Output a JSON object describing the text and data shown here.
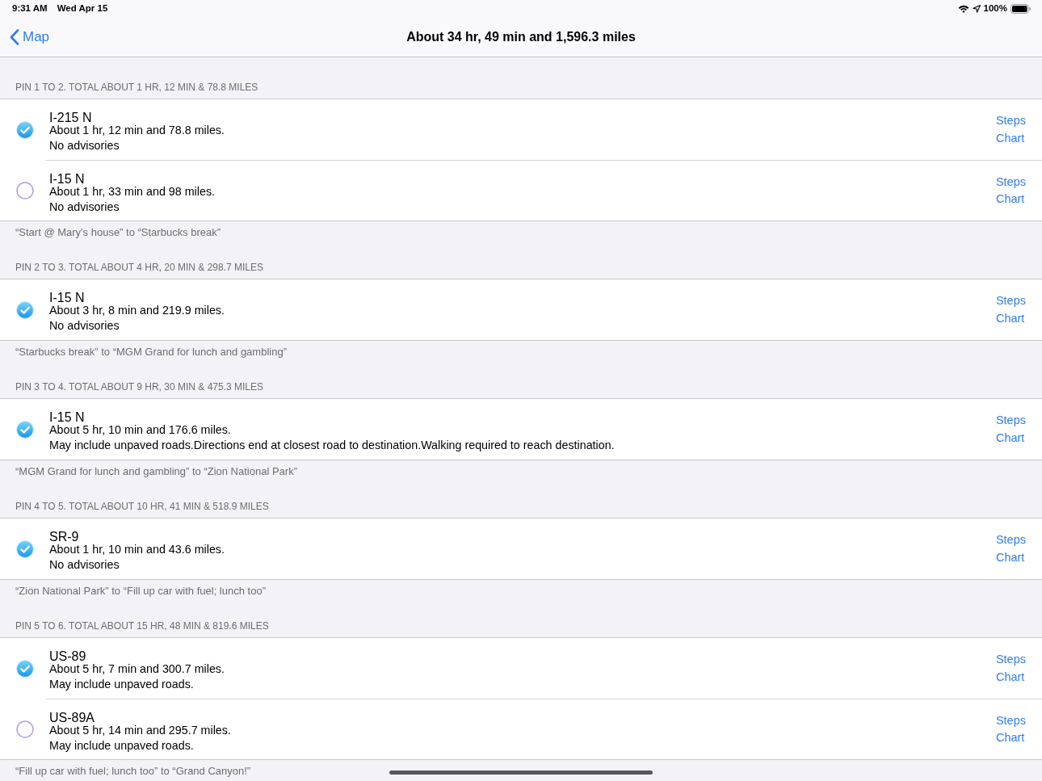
{
  "status_bar": {
    "time": "9:31 AM",
    "date": "Wed Apr 15",
    "battery": "100%"
  },
  "nav_bar": {
    "back": "Map",
    "title": "About 34 hr, 49 min and 1,596.3 miles"
  },
  "sections": [
    {
      "header": "PIN 1 TO 2. TOTAL ABOUT 1 HR, 12 MIN & 78.8 MILES",
      "routes": [
        {
          "name": "I-215 N",
          "summary": "About 1 hr, 12 min and 78.8 miles.",
          "advisory": "No advisories",
          "selected": true,
          "actions": [
            "Steps",
            "Chart"
          ]
        },
        {
          "name": "I-15 N",
          "summary": "About 1 hr, 33 min and 98 miles.",
          "advisory": "No advisories",
          "selected": false,
          "actions": [
            "Steps",
            "Chart"
          ]
        }
      ],
      "footer": "“Start @ Mary's house” to “Starbucks break”"
    },
    {
      "header": "PIN 2 TO 3. TOTAL ABOUT 4 HR, 20 MIN & 298.7 MILES",
      "routes": [
        {
          "name": "I-15 N",
          "summary": "About 3 hr, 8 min and 219.9 miles.",
          "advisory": "No advisories",
          "selected": true,
          "actions": [
            "Steps",
            "Chart"
          ]
        }
      ],
      "footer": "“Starbucks break” to “MGM Grand for lunch and gambling”"
    },
    {
      "header": "PIN 3 TO 4. TOTAL ABOUT 9 HR, 30 MIN & 475.3 MILES",
      "routes": [
        {
          "name": "I-15 N",
          "summary": "About 5 hr, 10 min and 176.6 miles.",
          "advisory": "May include unpaved roads.Directions end at closest road to destination.Walking required to reach destination.",
          "selected": true,
          "actions": [
            "Steps",
            "Chart"
          ]
        }
      ],
      "footer": "“MGM Grand for lunch and gambling” to “Zion National Park”"
    },
    {
      "header": "PIN 4 TO 5. TOTAL ABOUT 10 HR, 41 MIN & 518.9 MILES",
      "routes": [
        {
          "name": "SR-9",
          "summary": "About 1 hr, 10 min and 43.6 miles.",
          "advisory": "No advisories",
          "selected": true,
          "actions": [
            "Steps",
            "Chart"
          ]
        }
      ],
      "footer": "“Zion National Park” to “Fill up car with fuel; lunch too”"
    },
    {
      "header": "PIN 5 TO 6. TOTAL ABOUT 15 HR, 48 MIN & 819.6 MILES",
      "routes": [
        {
          "name": "US-89",
          "summary": "About 5 hr, 7 min and 300.7 miles.",
          "advisory": "May include unpaved roads.",
          "selected": true,
          "actions": [
            "Steps",
            "Chart"
          ]
        },
        {
          "name": "US-89A",
          "summary": "About 5 hr, 14 min and 295.7 miles.",
          "advisory": "May include unpaved roads.",
          "selected": false,
          "actions": [
            "Steps",
            "Chart"
          ]
        }
      ],
      "footer": "“Fill up car with fuel; lunch too” to “Grand Canyon!”"
    }
  ]
}
